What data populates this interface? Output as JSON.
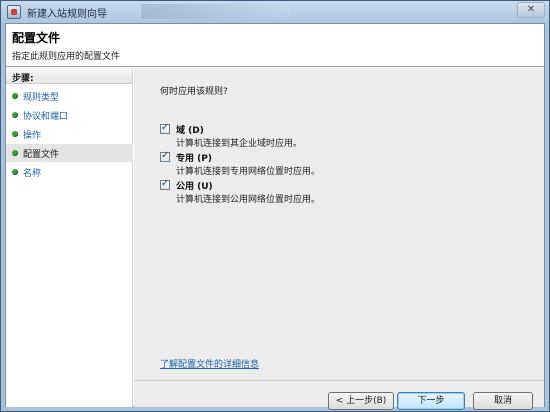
{
  "window": {
    "title": "新建入站规则向导",
    "close_glyph": "✕"
  },
  "header": {
    "title": "配置文件",
    "subtitle": "指定此规则应用的配置文件"
  },
  "steps": {
    "heading": "步骤:",
    "items": [
      {
        "label": "规则类型",
        "current": false
      },
      {
        "label": "协议和端口",
        "current": false
      },
      {
        "label": "操作",
        "current": false
      },
      {
        "label": "配置文件",
        "current": true
      },
      {
        "label": "名称",
        "current": false
      }
    ]
  },
  "main": {
    "question": "何时应用该规则?",
    "options": [
      {
        "label": "域 (D)",
        "description": "计算机连接到其企业域时应用。",
        "checked": true
      },
      {
        "label": "专用 (P)",
        "description": "计算机连接到专用网络位置时应用。",
        "checked": true
      },
      {
        "label": "公用 (U)",
        "description": "计算机连接到公用网络位置时应用。",
        "checked": true
      }
    ],
    "link": "了解配置文件的详细信息"
  },
  "buttons": {
    "back": "< 上一步(B)",
    "next": "下一步",
    "cancel": "取消"
  },
  "icons": {
    "window_icon": "firewall-icon",
    "step_dot": "green-dot-icon",
    "check": "checkmark-icon"
  },
  "colors": {
    "step_dot": "#3c9e3c",
    "link": "#1f5fa8",
    "default_button": "#bee6fd"
  }
}
